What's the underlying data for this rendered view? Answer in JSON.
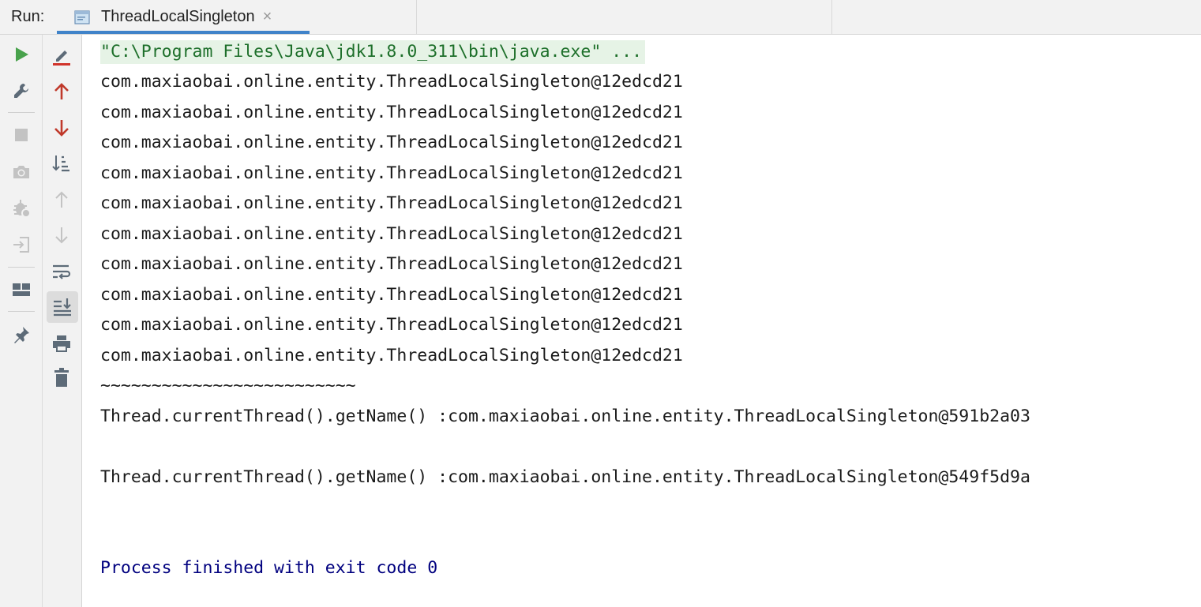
{
  "header": {
    "run_label": "Run:",
    "tab_title": "ThreadLocalSingleton",
    "close_glyph": "×"
  },
  "console": {
    "command": "\"C:\\Program Files\\Java\\jdk1.8.0_311\\bin\\java.exe\" ...",
    "lines": [
      "com.maxiaobai.online.entity.ThreadLocalSingleton@12edcd21",
      "com.maxiaobai.online.entity.ThreadLocalSingleton@12edcd21",
      "com.maxiaobai.online.entity.ThreadLocalSingleton@12edcd21",
      "com.maxiaobai.online.entity.ThreadLocalSingleton@12edcd21",
      "com.maxiaobai.online.entity.ThreadLocalSingleton@12edcd21",
      "com.maxiaobai.online.entity.ThreadLocalSingleton@12edcd21",
      "com.maxiaobai.online.entity.ThreadLocalSingleton@12edcd21",
      "com.maxiaobai.online.entity.ThreadLocalSingleton@12edcd21",
      "com.maxiaobai.online.entity.ThreadLocalSingleton@12edcd21",
      "com.maxiaobai.online.entity.ThreadLocalSingleton@12edcd21"
    ],
    "separator": "~~~~~~~~~~~~~~~~~~~~~~~~~",
    "thread_line_1": "Thread.currentThread().getName() :com.maxiaobai.online.entity.ThreadLocalSingleton@591b2a03",
    "thread_line_2": "Thread.currentThread().getName() :com.maxiaobai.online.entity.ThreadLocalSingleton@549f5d9a",
    "exit_message": "Process finished with exit code 0"
  },
  "toolbar_left": [
    {
      "name": "rerun-icon",
      "enabled": true
    },
    {
      "name": "wrench-icon",
      "enabled": true
    },
    {
      "name": "stop-icon",
      "enabled": false
    },
    {
      "name": "camera-icon",
      "enabled": false
    },
    {
      "name": "debug-bug-icon",
      "enabled": false
    },
    {
      "name": "exit-login-icon",
      "enabled": false
    },
    {
      "name": "layout-icon",
      "enabled": true
    },
    {
      "name": "pin-icon",
      "enabled": true
    }
  ],
  "toolbar_right": [
    {
      "name": "edit-config-icon",
      "enabled": true
    },
    {
      "name": "arrow-up-icon",
      "enabled": true
    },
    {
      "name": "arrow-down-icon",
      "enabled": true
    },
    {
      "name": "sort-icon",
      "enabled": true
    },
    {
      "name": "previous-occurrence-icon",
      "enabled": false
    },
    {
      "name": "next-occurrence-icon",
      "enabled": false
    },
    {
      "name": "soft-wrap-icon",
      "enabled": true
    },
    {
      "name": "scroll-to-end-icon",
      "enabled": true,
      "active": true
    },
    {
      "name": "print-icon",
      "enabled": true
    },
    {
      "name": "trash-icon",
      "enabled": true
    }
  ],
  "colors": {
    "accent": "#4083c9",
    "run_green": "#49a24c",
    "arrow_red": "#c0392b",
    "exit_blue": "#00007f",
    "command_bg": "#e6f3e6"
  }
}
